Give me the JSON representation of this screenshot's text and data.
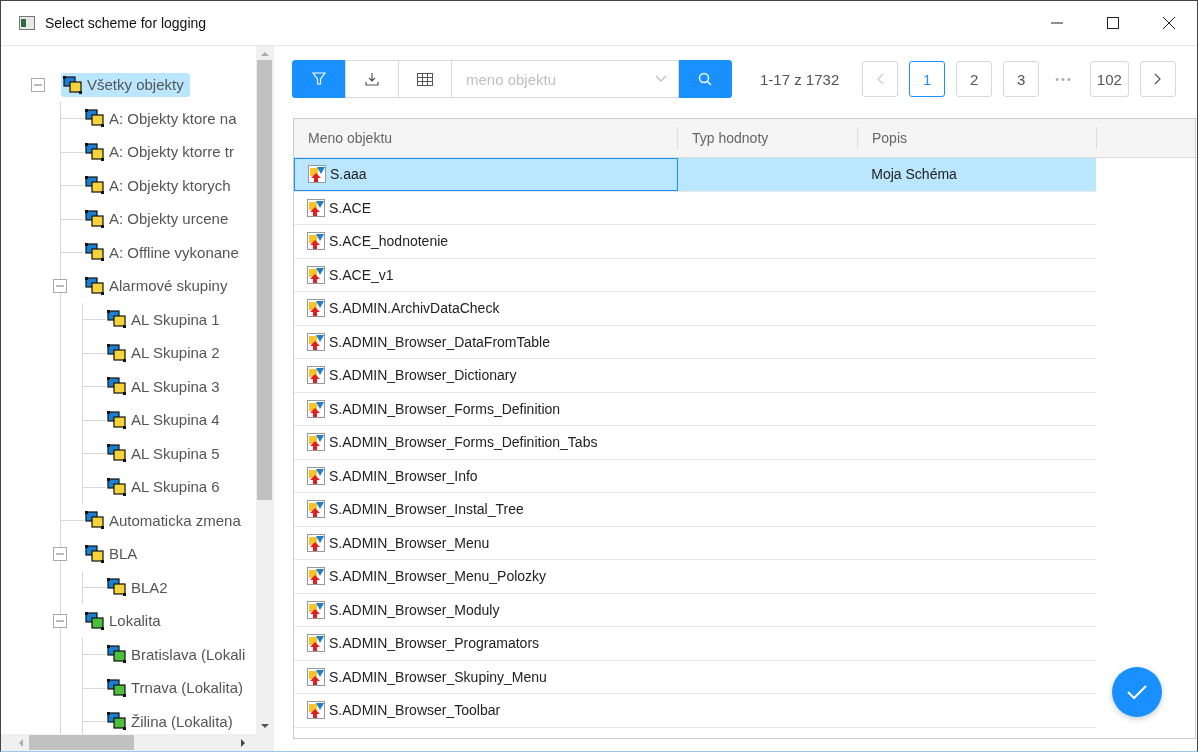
{
  "window": {
    "title": "Select scheme for logging"
  },
  "tree": [
    {
      "label": "Všetky objekty",
      "color": "#f7d33a",
      "selected": true,
      "expanded": true,
      "children": [
        {
          "label": "A: Objekty ktore na",
          "color": "#f7d33a",
          "selected": false
        },
        {
          "label": "A: Objekty ktorre tr",
          "color": "#f7d33a",
          "selected": false
        },
        {
          "label": "A: Objekty ktorych",
          "color": "#f7d33a",
          "selected": false
        },
        {
          "label": "A: Objekty urcene",
          "color": "#f7d33a",
          "selected": false
        },
        {
          "label": "A: Offline vykonane",
          "color": "#f7d33a",
          "selected": false
        },
        {
          "label": "Alarmové skupiny",
          "color": "#f7d33a",
          "selected": false,
          "expanded": true,
          "children": [
            {
              "label": "AL Skupina 1",
              "color": "#f7d33a",
              "selected": false
            },
            {
              "label": "AL Skupina 2",
              "color": "#f7d33a",
              "selected": false
            },
            {
              "label": "AL Skupina 3",
              "color": "#f7d33a",
              "selected": false
            },
            {
              "label": "AL Skupina 4",
              "color": "#f7d33a",
              "selected": false
            },
            {
              "label": "AL Skupina 5",
              "color": "#f7d33a",
              "selected": false
            },
            {
              "label": "AL Skupina 6",
              "color": "#f7d33a",
              "selected": false
            }
          ]
        },
        {
          "label": "Automaticka zmena",
          "color": "#f7d33a",
          "selected": false
        },
        {
          "label": "BLA",
          "color": "#f7d33a",
          "selected": false,
          "expanded": true,
          "children": [
            {
              "label": "BLA2",
              "color": "#f7d33a",
              "selected": false
            }
          ]
        },
        {
          "label": "Lokalita",
          "color": "#4cbf3c",
          "selected": false,
          "expanded": true,
          "children": [
            {
              "label": "Bratislava (Lokali",
              "color": "#4cbf3c",
              "selected": false
            },
            {
              "label": "Trnava (Lokalita)",
              "color": "#4cbf3c",
              "selected": false
            },
            {
              "label": "Žilina (Lokalita)",
              "color": "#4cbf3c",
              "selected": false
            }
          ]
        }
      ]
    }
  ],
  "toolbar": {
    "filter_active": true,
    "search": {
      "placeholder": "meno objektu"
    }
  },
  "pagination": {
    "range": "1-17 z 1732",
    "prev_disabled": true,
    "ellipsis": "•••",
    "pages": [
      {
        "label": "1",
        "selected": true
      },
      {
        "label": "2",
        "selected": false
      },
      {
        "label": "3",
        "selected": false
      },
      {
        "label": "102",
        "selected": false
      }
    ]
  },
  "table": {
    "columns": [
      "Meno objektu",
      "Typ hodnoty",
      "Popis"
    ],
    "rows": [
      {
        "name": "S.aaa",
        "description": "Moja Schéma",
        "selected": true
      },
      {
        "name": "S.ACE",
        "selected": false
      },
      {
        "name": "S.ACE_hodnotenie",
        "selected": false
      },
      {
        "name": "S.ACE_v1",
        "selected": false
      },
      {
        "name": "S.ADMIN.ArchivDataCheck",
        "selected": false
      },
      {
        "name": "S.ADMIN_Browser_DataFromTable",
        "selected": false
      },
      {
        "name": "S.ADMIN_Browser_Dictionary",
        "selected": false
      },
      {
        "name": "S.ADMIN_Browser_Forms_Definition",
        "selected": false
      },
      {
        "name": "S.ADMIN_Browser_Forms_Definition_Tabs",
        "selected": false
      },
      {
        "name": "S.ADMIN_Browser_Info",
        "selected": false
      },
      {
        "name": "S.ADMIN_Browser_Instal_Tree",
        "selected": false
      },
      {
        "name": "S.ADMIN_Browser_Menu",
        "selected": false
      },
      {
        "name": "S.ADMIN_Browser_Menu_Polozky",
        "selected": false
      },
      {
        "name": "S.ADMIN_Browser_Moduly",
        "selected": false
      },
      {
        "name": "S.ADMIN_Browser_Programators",
        "selected": false
      },
      {
        "name": "S.ADMIN_Browser_Skupiny_Menu",
        "selected": false
      },
      {
        "name": "S.ADMIN_Browser_Toolbar",
        "selected": false
      }
    ]
  }
}
